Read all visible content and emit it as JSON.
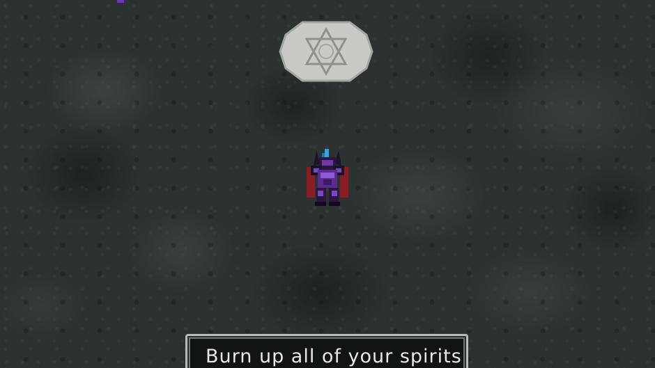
{
  "dialog": {
    "text": "Burn up all of your spirits"
  },
  "colors": {
    "cave_floor": "#2b3231",
    "seal_stone": "#c9cac6",
    "hero_armor": "#5b2a8c",
    "hero_cape": "#8b1c24",
    "hero_crest": "#3aa0e6",
    "dialog_border": "#b9bcbc",
    "dialog_text": "#e8e8e8"
  },
  "icons": {
    "seal": "summoning-seal-icon",
    "hero": "armored-hero-sprite",
    "corner": "purple-sprite-fragment"
  }
}
